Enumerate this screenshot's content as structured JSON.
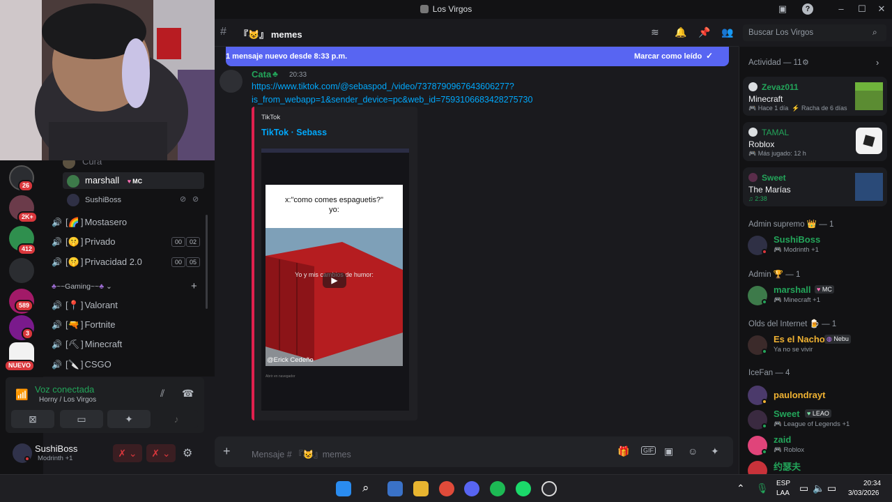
{
  "window": {
    "title": "Los Virgos"
  },
  "servers": [
    {
      "badge": "26"
    },
    {
      "badge": "2K+"
    },
    {
      "badge": "412"
    },
    {
      "badge": ""
    },
    {
      "badge": "589"
    },
    {
      "badge": "3"
    },
    {
      "badge": "NUEVO"
    }
  ],
  "voice_users": [
    {
      "name": "Cura"
    },
    {
      "name": "marshall",
      "tag": "MC"
    },
    {
      "name": "SushiBoss"
    }
  ],
  "channels": [
    {
      "emoji": "🌈",
      "name": "Mostasero"
    },
    {
      "emoji": "🤫",
      "name": "Privado",
      "count_a": "00",
      "count_b": "02"
    },
    {
      "emoji": "🤫",
      "name": "Privacidad 2.0",
      "count_a": "00",
      "count_b": "05"
    }
  ],
  "category": {
    "label": "~~Gaming~~"
  },
  "game_channels": [
    {
      "emoji": "📍",
      "name": "Valorant"
    },
    {
      "emoji": "🔫",
      "name": "Fortnite"
    },
    {
      "emoji": "⛏",
      "name": "Minecraft"
    },
    {
      "emoji": "🔪",
      "name": "CSGO"
    }
  ],
  "voice_panel": {
    "status": "Voz conectada",
    "location": "Horny / Los Virgos"
  },
  "user_panel": {
    "name": "SushiBoss",
    "activity": "Modrinth +1"
  },
  "chat": {
    "channel_name": "memes",
    "channel_emoji": "😺",
    "search_placeholder": "Buscar Los Virgos",
    "new_message_bar": "1 mensaje nuevo desde 8:33 p.m.",
    "mark_read": "Marcar como leído",
    "message": {
      "author": "Cata",
      "time": "20:33",
      "link_line1": "https://www.tiktok.com/@sebaspod_/video/7378790967643606277?",
      "link_line2": "is_from_webapp=1&sender_device=pc&web_id=7593106683428275730"
    },
    "embed": {
      "provider": "TikTok",
      "title": "TikTok · Sebass",
      "video_caption_line1": "x:\"como comes espaguetis?\"",
      "video_caption_line2": "yo:",
      "video_overlay": "Yo y mis cambios de humor:",
      "video_credit": "@Erick Cedeño",
      "video_footer": "Abrir en navegador"
    },
    "composer_placeholder": "Mensaje # 『😺』memes"
  },
  "activity": {
    "header": "Actividad — 11",
    "cards": [
      {
        "user": "Zevaz011",
        "game": "Minecraft",
        "meta1": "Hace 1 día",
        "meta2": "Racha de 6 días",
        "user_color": "#23a55a"
      },
      {
        "user": "TAMAL",
        "game": "Roblox",
        "meta1": "Más jugado: 12 h",
        "meta2": "",
        "user_color": "#23a55a"
      },
      {
        "user": "Sweet",
        "game": "The Marías",
        "meta1": "2:38",
        "meta2": "",
        "user_color": "#23a55a"
      }
    ]
  },
  "member_groups": [
    {
      "header": "Admin supremo 👑 — 1",
      "members": [
        {
          "name": "SushiBoss",
          "sub": "Modrinth +1",
          "color": "#23a55a"
        }
      ]
    },
    {
      "header": "Admin 🏆 — 1",
      "members": [
        {
          "name": "marshall",
          "tag": "MC",
          "sub": "Minecraft +1",
          "color": "#23a55a"
        }
      ]
    },
    {
      "header": "Olds del Internet 🍺 — 1",
      "members": [
        {
          "name": "Es el Nacho",
          "tag": "Nebu",
          "sub": "Ya no se vivir",
          "color": "#f0b232"
        }
      ]
    },
    {
      "header": "IceFan — 4",
      "members": [
        {
          "name": "paulondrayt",
          "sub": "",
          "color": "#f0b232"
        },
        {
          "name": "Sweet",
          "tag": "LEAO",
          "sub": "League of Legends +1",
          "color": "#23a55a"
        },
        {
          "name": "zaid",
          "sub": "Roblox",
          "color": "#23a55a"
        },
        {
          "name": "约瑟夫",
          "sub": "",
          "color": "#23a55a"
        }
      ]
    }
  ],
  "taskbar": {
    "lang1": "ESP",
    "lang2": "LAA",
    "time": "20:34",
    "date": "3/03/2026"
  },
  "colors": {
    "accent": "#5865f2",
    "online": "#23a55a",
    "embed_bar": "#e0204e",
    "link": "#00a8fc"
  }
}
